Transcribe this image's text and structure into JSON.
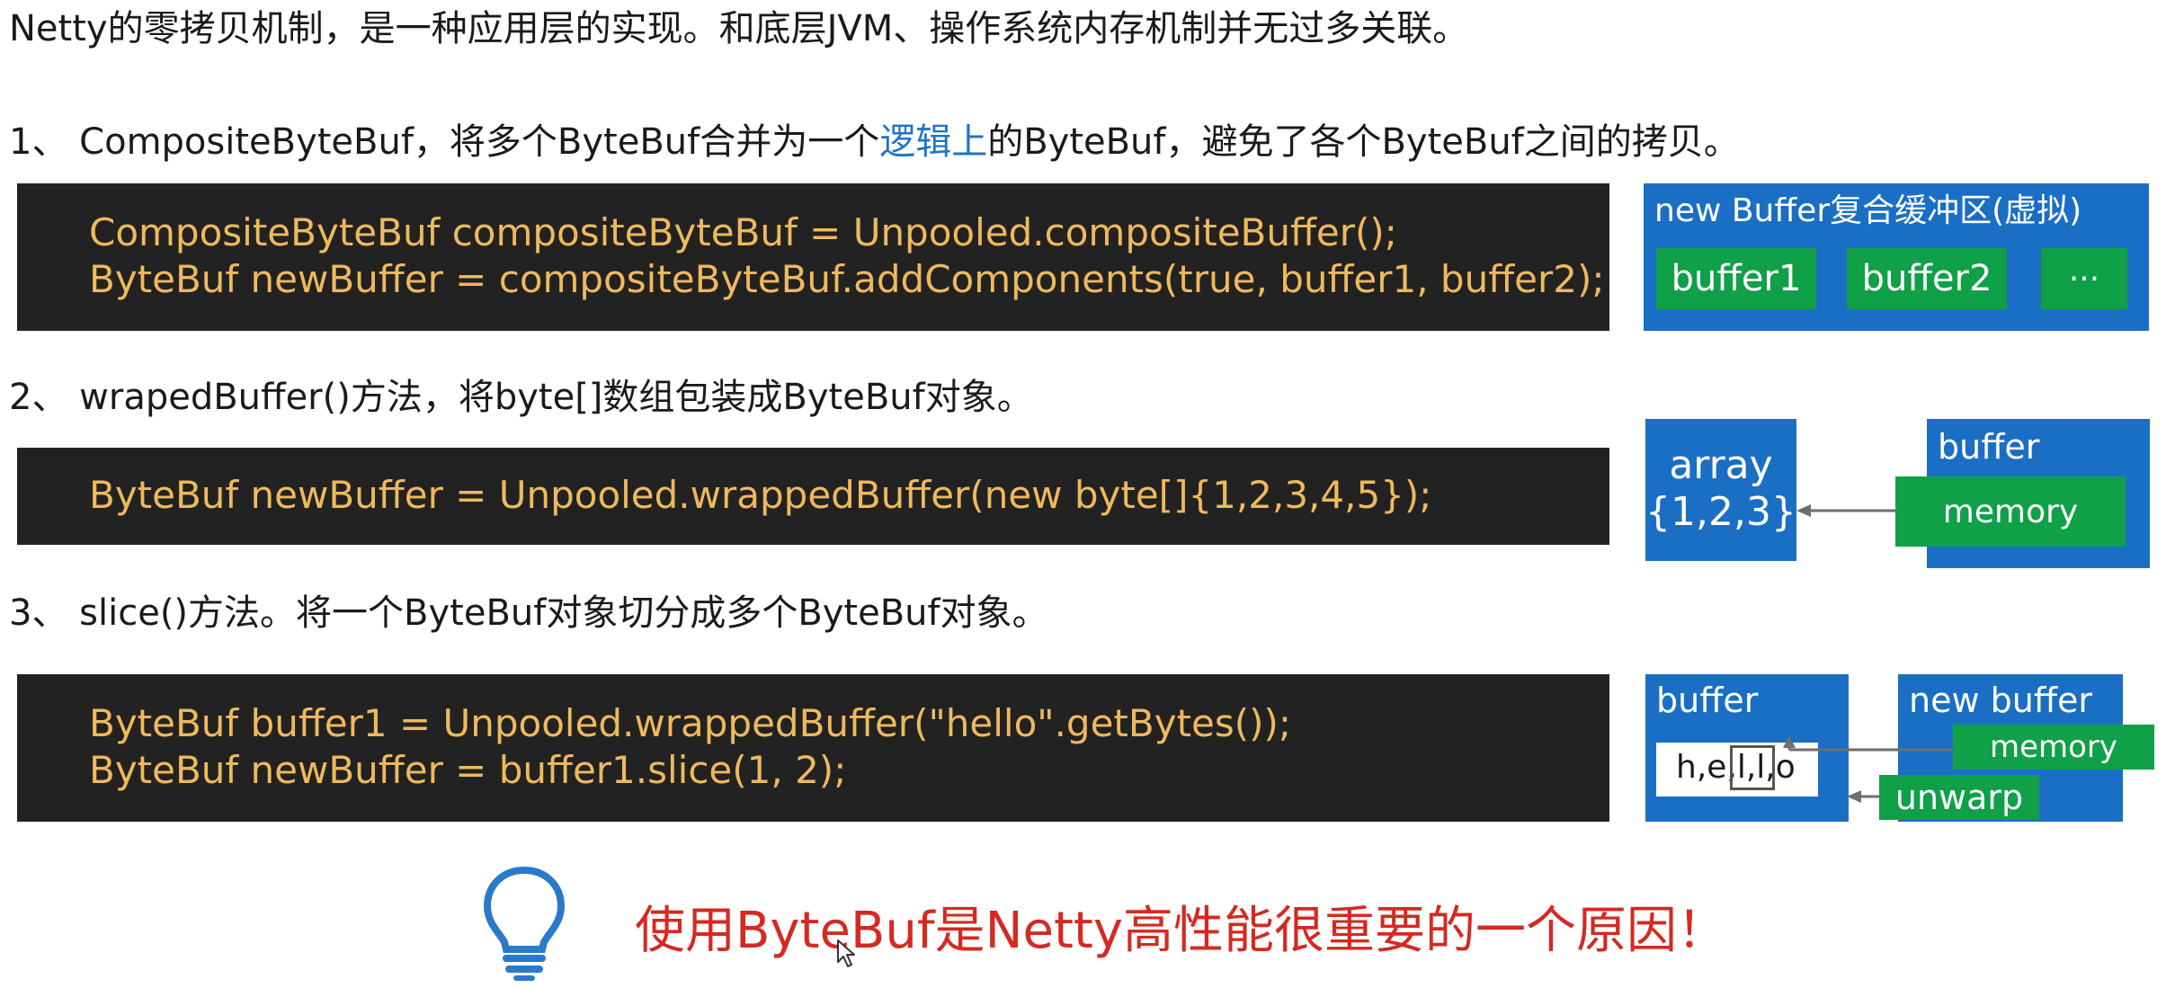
{
  "intro": "Netty的零拷贝机制，是一种应用层的实现。和底层JVM、操作系统内存机制并无过多关联。",
  "section1": {
    "heading_pre": "1、 CompositeByteBuf，将多个ByteBuf合并为一个",
    "heading_highlight": "逻辑上",
    "heading_post": "的ByteBuf，避免了各个ByteBuf之间的拷贝。",
    "code": [
      "CompositeByteBuf compositeByteBuf = Unpooled.compositeBuffer();",
      "ByteBuf newBuffer = compositeByteBuf.addComponents(true, buffer1, buffer2);"
    ],
    "diagram": {
      "title": "new Buffer复合缓冲区(虚拟)",
      "items": [
        "buffer1",
        "buffer2",
        "···"
      ]
    }
  },
  "section2": {
    "heading": "2、 wrapedBuffer()方法，将byte[]数组包装成ByteBuf对象。",
    "code": [
      "ByteBuf newBuffer = Unpooled.wrappedBuffer(new byte[]{1,2,3,4,5});"
    ],
    "diagram": {
      "array_label": "array",
      "array_values": "{1,2,3}",
      "buffer_label": "buffer",
      "memory_label": "memory"
    }
  },
  "section3": {
    "heading": "3、 slice()方法。将一个ByteBuf对象切分成多个ByteBuf对象。",
    "code": [
      "ByteBuf buffer1 = Unpooled.wrappedBuffer(\"hello\".getBytes());",
      "ByteBuf newBuffer = buffer1.slice(1, 2);"
    ],
    "diagram": {
      "buffer_label": "buffer",
      "content": "h,e,l,l,o",
      "new_buffer_label": "new buffer",
      "memory_label": "memory",
      "unwarp_label": "unwarp"
    }
  },
  "conclusion": "使用ByteBuf是Netty高性能很重要的一个原因！",
  "colors": {
    "code_bg": "#222222",
    "code_text": "#efb95c",
    "diagram_blue": "#1a6fc4",
    "diagram_green": "#0fa048",
    "highlight": "#1f74c4",
    "conclusion": "#d42a21"
  },
  "icons": [
    "lightbulb-icon",
    "mouse-cursor-icon"
  ]
}
